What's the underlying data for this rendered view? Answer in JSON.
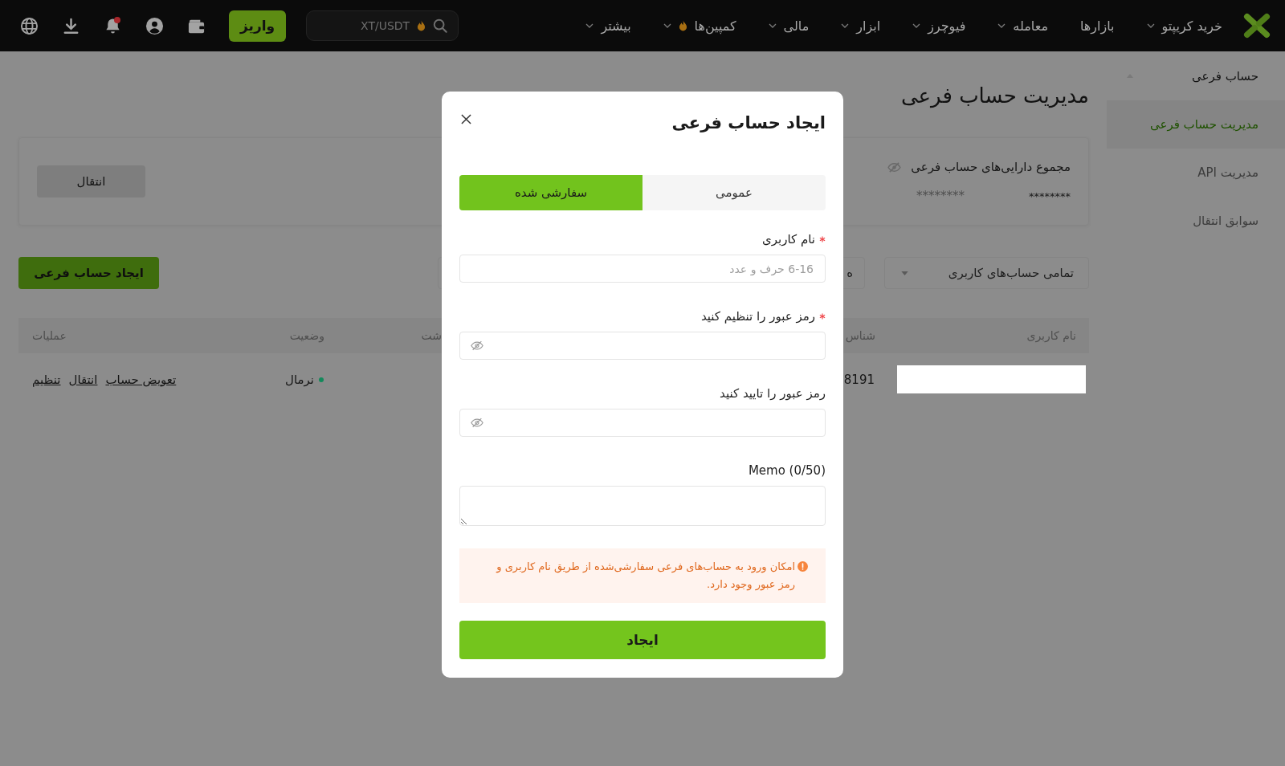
{
  "top_nav": {
    "menu": [
      {
        "label": "خرید کریپتو",
        "has_dropdown": true,
        "hot": false
      },
      {
        "label": "بازارها",
        "has_dropdown": false,
        "hot": false
      },
      {
        "label": "معامله",
        "has_dropdown": true,
        "hot": false
      },
      {
        "label": "فیوچرز",
        "has_dropdown": true,
        "hot": false
      },
      {
        "label": "ابزار",
        "has_dropdown": true,
        "hot": false
      },
      {
        "label": "مالی",
        "has_dropdown": true,
        "hot": false
      },
      {
        "label": "کمپین‌ها",
        "has_dropdown": true,
        "hot": true
      },
      {
        "label": "بیشتر",
        "has_dropdown": true,
        "hot": false
      }
    ],
    "search": {
      "placeholder": "XT/USDT",
      "hot": true
    },
    "deposit_button": "واریز",
    "notifications_unread": true
  },
  "sidebar": {
    "group": {
      "label": "حساب فرعی",
      "expanded": true,
      "children": [
        {
          "label": "مدیریت حساب فرعی",
          "selected": true
        },
        {
          "label": "مدیریت API",
          "selected": false
        },
        {
          "label": "سوابق انتقال",
          "selected": false
        }
      ]
    }
  },
  "page": {
    "title": "مدیریت حساب فرعی",
    "assets_card": {
      "title": "مجموع دارایی‌های حساب فرعی",
      "values_hidden": true,
      "total": "********",
      "equivalent": "********",
      "transfer_button": "انتقال"
    },
    "filters": [
      {
        "kind": "dropdown",
        "value": "تمامی حساب‌های کاربری"
      },
      {
        "kind": "field",
        "value": "ه"
      }
    ],
    "create_button": "ایجاد حساب فرعی",
    "table": {
      "columns": [
        "نام کاربری",
        "شناس",
        "شت",
        "وضعیت",
        "عملیات"
      ],
      "rows": [
        {
          "username_redacted": true,
          "column_2": "8191",
          "status": {
            "label": "نرمال",
            "color": "#13895b"
          },
          "actions": [
            "تعویض حساب",
            "انتقال",
            "تنظیم"
          ]
        }
      ]
    }
  },
  "modal": {
    "title": "ایجاد حساب فرعی",
    "tabs": [
      {
        "label": "عمومی",
        "selected": false
      },
      {
        "label": "سفارشی شده",
        "selected": true
      }
    ],
    "fields": [
      {
        "kind": "text",
        "label": "نام کاربری",
        "required": true,
        "placeholder": "6-16 حرف و عدد"
      },
      {
        "kind": "password",
        "label": "رمز عبور را تنظیم کنید",
        "required": true
      },
      {
        "kind": "password",
        "label": "رمز عبور را تایید کنید",
        "required": false
      },
      {
        "kind": "textarea",
        "label": "Memo (0/50)",
        "required": false
      }
    ],
    "notice": "امکان ورود به حساب‌های فرعی سفارشی‌شده از طریق نام کاربری و رمز عبور وجود دارد.",
    "submit_button": "ایجاد"
  }
}
